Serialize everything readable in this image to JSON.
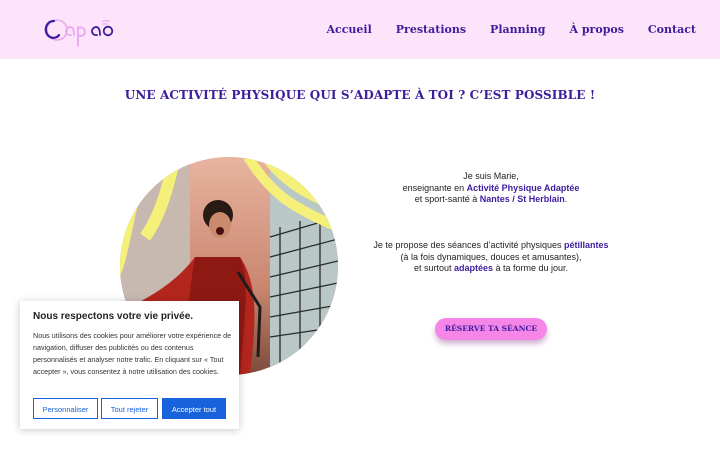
{
  "header": {
    "logo_text": "capao",
    "nav": [
      "Accueil",
      "Prestations",
      "Planning",
      "À propos",
      "Contact"
    ]
  },
  "headline": "UNE ACTIVITÉ PHYSIQUE QUI S’ADAPTE À TOI ? C’EST POSSIBLE !",
  "intro": {
    "line1": "Je suis Marie,",
    "line2_pre": "enseignante en ",
    "line2_hl": "Activité Physique Adaptée",
    "line3_pre": "et sport-santé à ",
    "line3_hl": "Nantes / St Herblain",
    "line3_post": ".",
    "p2_line1_pre": "Je te propose des séances d’activité physiques ",
    "p2_line1_hl": "pétillantes",
    "p2_line2": "(à la fois dynamiques, douces et amusantes),",
    "p2_line3_pre": "et surtout ",
    "p2_line3_hl": "adaptées",
    "p2_line3_post": " à ta forme du jour."
  },
  "cta_label": "RÉSERVE TA SÉANCE",
  "cookie": {
    "title": "Nous respectons votre vie privée.",
    "body": "Nous utilisons des cookies pour améliorer votre expérience de navigation, diffuser des publicités ou des contenus personnalisés et analyser notre trafic. En cliquant sur « Tout accepter », vous consentez à notre utilisation des cookies.",
    "btn_customize": "Personnaliser",
    "btn_reject": "Tout rejeter",
    "btn_accept": "Accepter tout"
  },
  "colors": {
    "header_bg": "#fde4fa",
    "brand_purple": "#3d1d9e",
    "cta_pink": "#f586e8",
    "cookie_blue": "#1863dc",
    "accent_yellow": "#f5f07a"
  }
}
